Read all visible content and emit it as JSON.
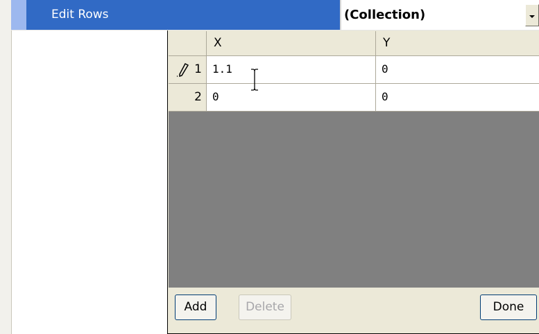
{
  "property": {
    "name": "Edit Rows",
    "value": "(Collection)"
  },
  "grid": {
    "columns": [
      "X",
      "Y"
    ],
    "rows": [
      {
        "header": "1",
        "x": "1.1",
        "y": "0",
        "editing": true
      },
      {
        "header": "2",
        "x": "0",
        "y": "0",
        "editing": false
      }
    ]
  },
  "buttons": {
    "add": "Add",
    "delete": "Delete",
    "done": "Done"
  },
  "icons": {
    "dropdown": "chevron-down-icon",
    "edit_row": "pencil-icon",
    "cursor": "text-cursor-icon"
  },
  "colors": {
    "selection": "#316ac5",
    "grid_background": "#808080"
  }
}
